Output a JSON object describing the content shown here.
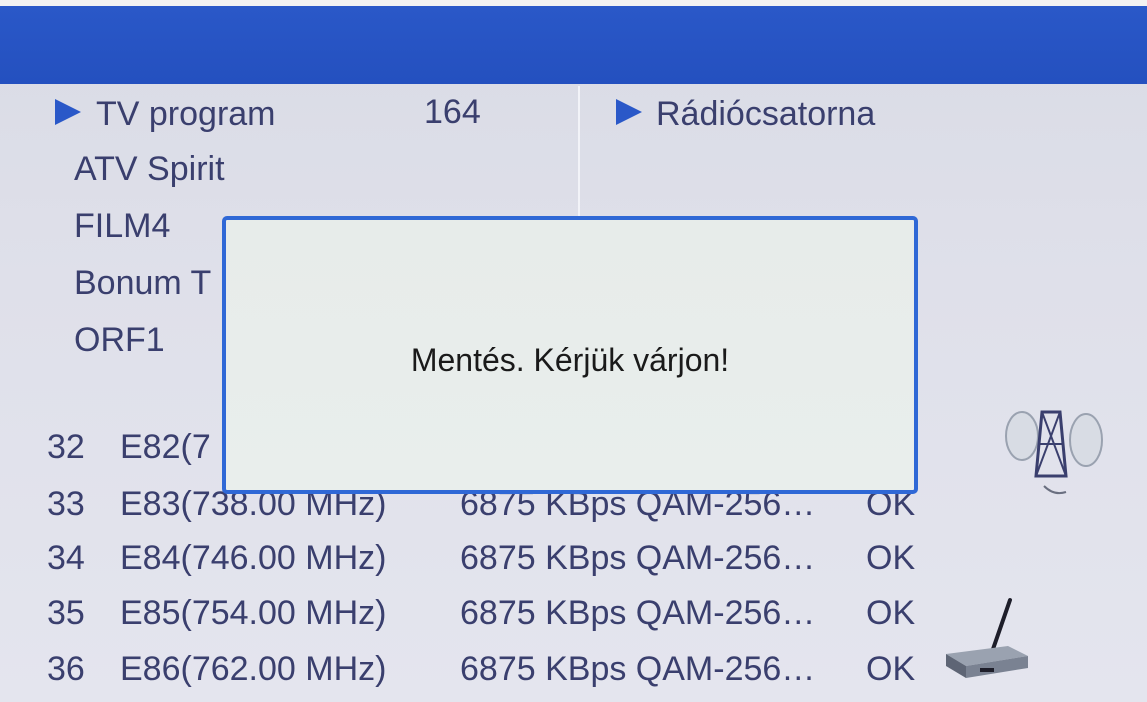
{
  "header": {
    "title": ""
  },
  "left_panel": {
    "tv_label": "TV program",
    "tv_count": "164",
    "channels": [
      "ATV Spirit",
      "FILM4",
      "Bonum T",
      "ORF1"
    ]
  },
  "right_panel": {
    "radio_label": "Rádiócsatorna"
  },
  "scan_list": [
    {
      "num": "32",
      "freq": "E82(7",
      "info": "",
      "status": ""
    },
    {
      "num": "33",
      "freq": "E83(738.00 MHz)",
      "info": "6875 KBps QAM-256…",
      "status": "OK"
    },
    {
      "num": "34",
      "freq": "E84(746.00 MHz)",
      "info": "6875 KBps QAM-256…",
      "status": "OK"
    },
    {
      "num": "35",
      "freq": "E85(754.00 MHz)",
      "info": "6875 KBps QAM-256…",
      "status": "OK"
    },
    {
      "num": "36",
      "freq": "E86(762.00 MHz)",
      "info": "6875 KBps QAM-256…",
      "status": "OK"
    }
  ],
  "dialog": {
    "message": "Mentés. Kérjük várjon!"
  },
  "icons": {
    "satellite": "satellite-dish-icon",
    "antenna": "antenna-receiver-icon",
    "play": "play-triangle-icon"
  },
  "colors": {
    "header_bar": "#2450bf",
    "dialog_border": "#2f68d6",
    "text": "#3a3f6e"
  }
}
